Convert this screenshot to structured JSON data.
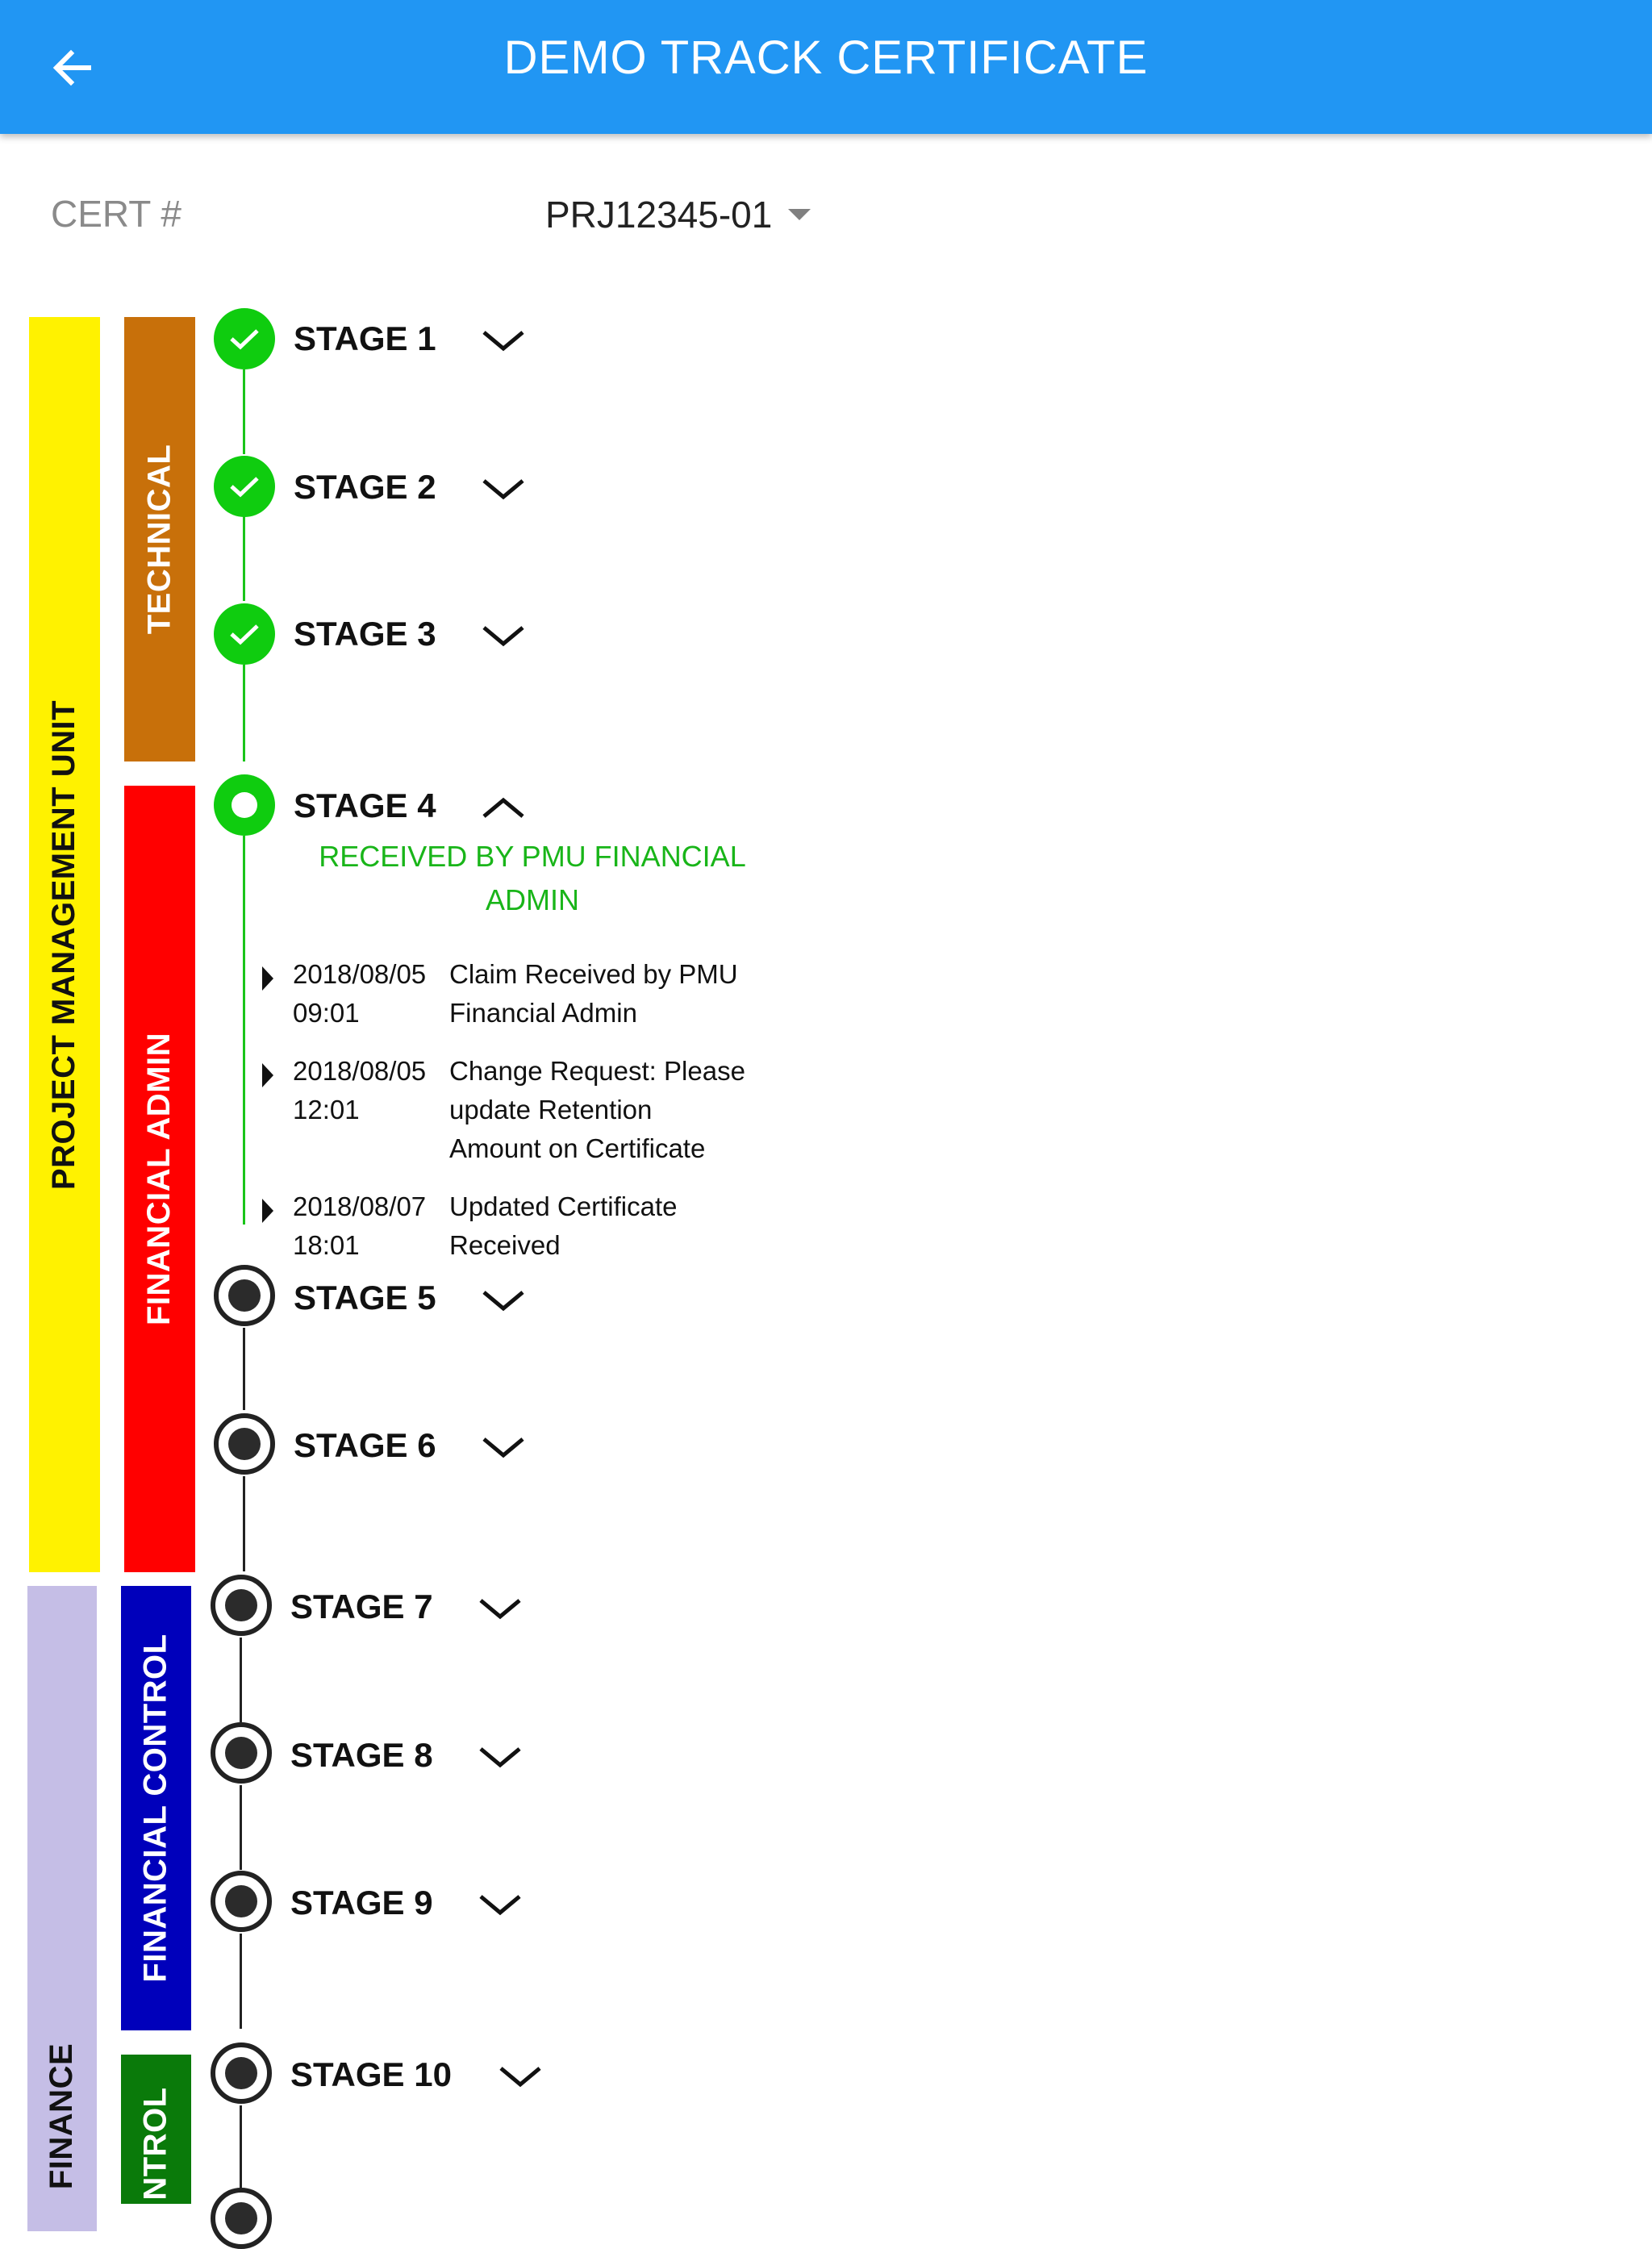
{
  "header": {
    "title": "DEMO TRACK CERTIFICATE",
    "back_icon": "arrow-left-icon"
  },
  "cert": {
    "label": "CERT #",
    "value": "PRJ12345-01"
  },
  "bands": {
    "project_management_unit": {
      "label": "PROJECT MANAGEMENT UNIT",
      "color": "#FFF200"
    },
    "technical": {
      "label": "TECHNICAL",
      "color": "#C8700A"
    },
    "financial_admin": {
      "label": "FINANCIAL ADMIN",
      "color": "#FF0000"
    },
    "finance": {
      "label": "FINANCE",
      "color": "#C5BEE6"
    },
    "financial_control": {
      "label": "FINANCIAL CONTROL",
      "color": "#0000BB"
    },
    "control": {
      "label": "NTROL",
      "color": "#0A7A0A"
    }
  },
  "stages": [
    {
      "label": "STAGE 1",
      "status": "done"
    },
    {
      "label": "STAGE 2",
      "status": "done"
    },
    {
      "label": "STAGE 3",
      "status": "done"
    },
    {
      "label": "STAGE 4",
      "status": "current",
      "expanded": true
    },
    {
      "label": "STAGE 5",
      "status": "pending"
    },
    {
      "label": "STAGE 6",
      "status": "pending"
    },
    {
      "label": "STAGE 7",
      "status": "pending"
    },
    {
      "label": "STAGE 8",
      "status": "pending"
    },
    {
      "label": "STAGE 9",
      "status": "pending"
    },
    {
      "label": "STAGE 10",
      "status": "pending"
    }
  ],
  "stage4_detail": {
    "status_line1": "RECEIVED BY PMU FINANCIAL",
    "status_line2": "ADMIN",
    "events": [
      {
        "date": "2018/08/05",
        "time": "09:01",
        "desc": [
          "Claim Received by PMU",
          "Financial Admin"
        ]
      },
      {
        "date": "2018/08/05",
        "time": "12:01",
        "desc": [
          "Change Request: Please",
          "update Retention",
          "Amount on Certificate"
        ]
      },
      {
        "date": "2018/08/07",
        "time": "18:01",
        "desc": [
          "Updated Certificate",
          "Received"
        ]
      }
    ]
  }
}
